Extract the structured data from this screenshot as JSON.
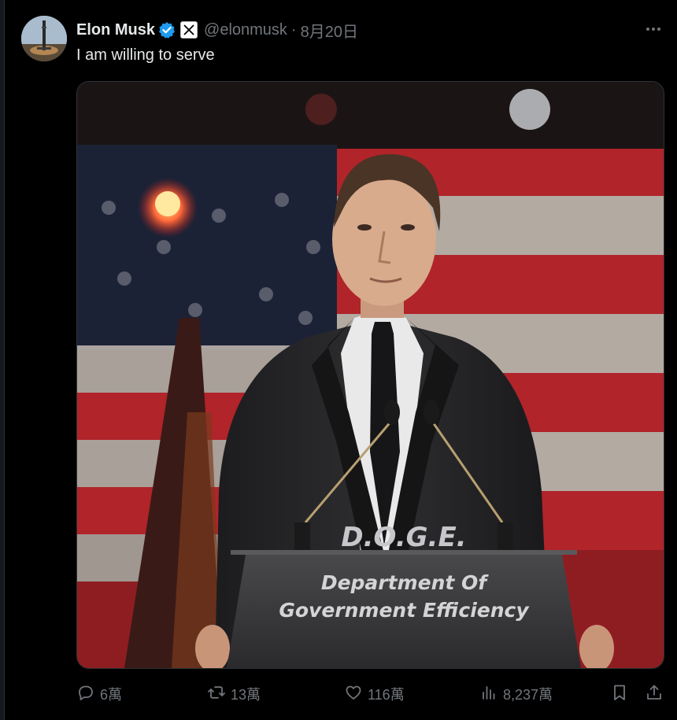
{
  "tweet": {
    "author_name": "Elon Musk",
    "handle": "@elonmusk",
    "separator": "·",
    "date": "8月20日",
    "text": "I am willing to serve",
    "image": {
      "sign_acronym": "D.O.G.E.",
      "podium_line1": "Department Of",
      "podium_line2": "Government Efficiency"
    }
  },
  "actions": {
    "replies": "6萬",
    "reposts": "13萬",
    "likes": "116萬",
    "views": "8,237萬"
  },
  "colors": {
    "background": "#000000",
    "text_primary": "#e7e9ea",
    "text_secondary": "#71767b",
    "verified_blue": "#1d9bf0"
  },
  "icons": [
    "verified-badge-icon",
    "x-logo-icon",
    "more-icon",
    "reply-icon",
    "repost-icon",
    "like-icon",
    "views-icon",
    "bookmark-icon",
    "share-icon"
  ]
}
